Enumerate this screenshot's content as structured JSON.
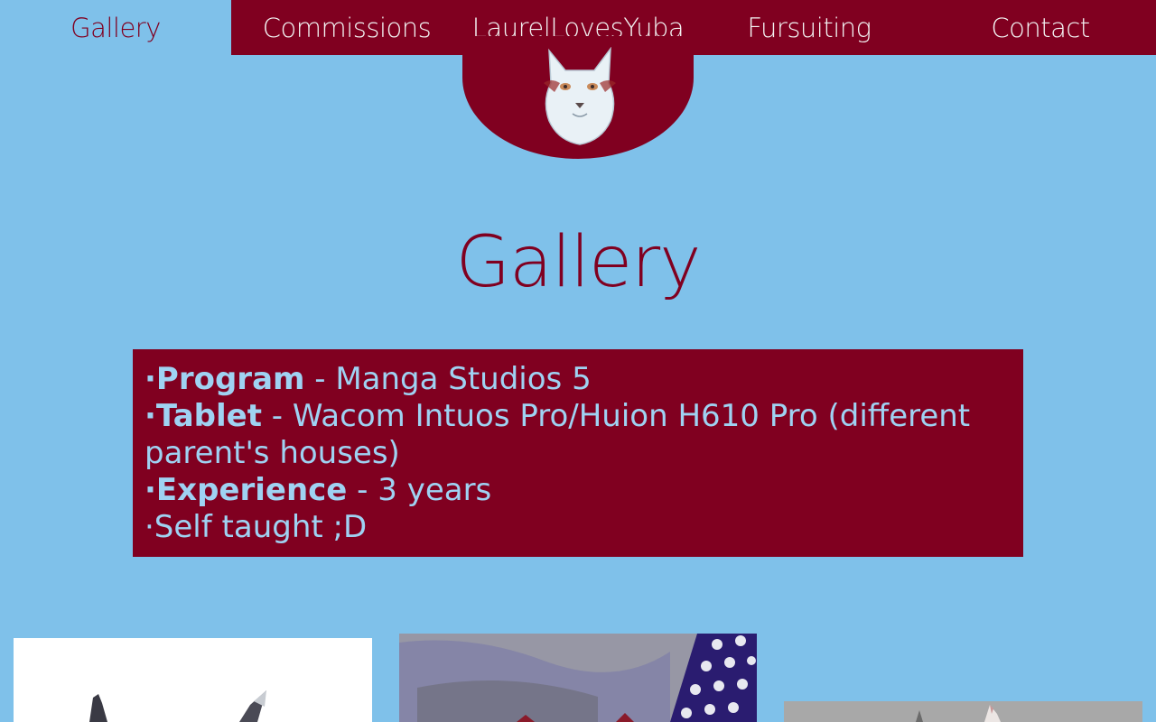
{
  "nav": {
    "items": [
      {
        "label": "Gallery",
        "active": true
      },
      {
        "label": "Commissions",
        "active": false
      },
      {
        "label": "LaurelLovesYuba",
        "active": false
      },
      {
        "label": "Fursuiting",
        "active": false
      },
      {
        "label": "Contact",
        "active": false
      }
    ]
  },
  "logo": {
    "icon": "white-cat-head-icon"
  },
  "page": {
    "title": "Gallery"
  },
  "info": {
    "program_label": "·Program",
    "program_value": " - Manga Studios 5",
    "tablet_label": "·Tablet",
    "tablet_value": " - Wacom Intuos Pro/Huion H610 Pro (different parent's houses)",
    "experience_label": "·Experience",
    "experience_value": " - 3 years",
    "note": "·Self taught ;D"
  },
  "colors": {
    "background": "#7fc1ea",
    "accent": "#800020",
    "text_light": "#9fd2f2"
  }
}
